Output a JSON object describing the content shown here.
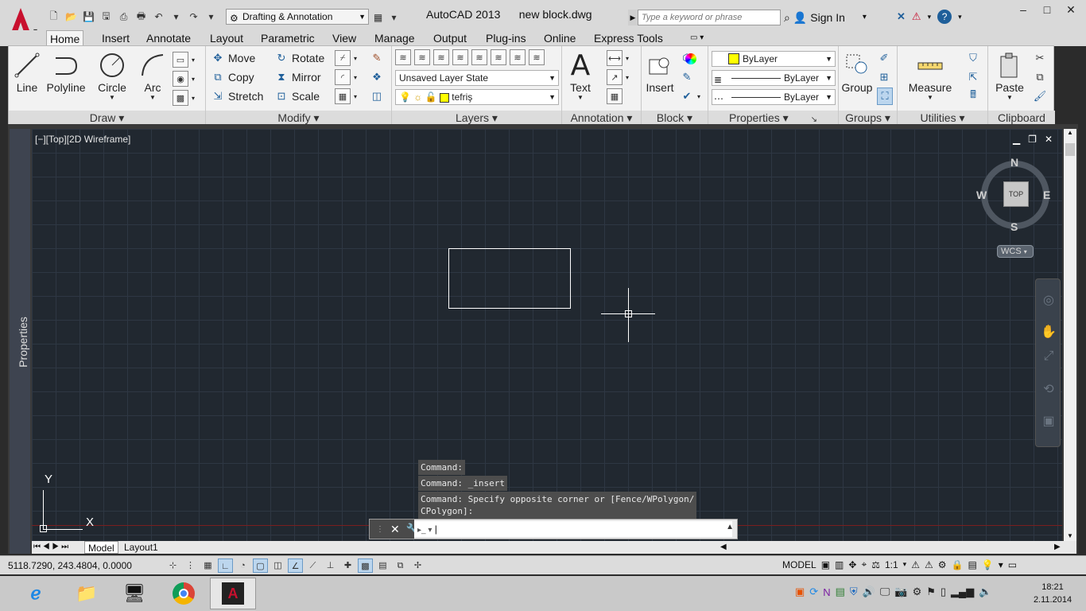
{
  "titlebar": {
    "workspace": "Drafting & Annotation",
    "app_name": "AutoCAD 2013",
    "document": "new block.dwg",
    "search_placeholder": "Type a keyword or phrase",
    "signin": "Sign In"
  },
  "ribbon_tabs": [
    "Home",
    "Insert",
    "Annotate",
    "Layout",
    "Parametric",
    "View",
    "Manage",
    "Output",
    "Plug-ins",
    "Online",
    "Express Tools"
  ],
  "ribbon": {
    "draw": {
      "title": "Draw",
      "line": "Line",
      "polyline": "Polyline",
      "circle": "Circle",
      "arc": "Arc"
    },
    "modify": {
      "title": "Modify",
      "move": "Move",
      "rotate": "Rotate",
      "copy": "Copy",
      "mirror": "Mirror",
      "stretch": "Stretch",
      "scale": "Scale"
    },
    "layers": {
      "title": "Layers",
      "layer_state": "Unsaved Layer State",
      "current_layer": "tefriş"
    },
    "annotation": {
      "title": "Annotation",
      "text": "Text"
    },
    "block": {
      "title": "Block",
      "insert": "Insert"
    },
    "properties": {
      "title": "Properties",
      "color": "ByLayer",
      "lineweight": "ByLayer",
      "linetype": "ByLayer"
    },
    "groups": {
      "title": "Groups",
      "group": "Group"
    },
    "utilities": {
      "title": "Utilities",
      "measure": "Measure"
    },
    "clipboard": {
      "title": "Clipboard",
      "paste": "Paste"
    }
  },
  "drawing": {
    "viewport_label": "[−][Top][2D Wireframe]",
    "properties_palette": "Properties",
    "viewcube": {
      "top": "TOP",
      "n": "N",
      "s": "S",
      "e": "E",
      "w": "W",
      "wcs": "WCS"
    },
    "ucs_x": "X",
    "ucs_y": "Y"
  },
  "command": {
    "history": [
      "Command:",
      "Command: _insert",
      "Command: Specify opposite corner or [Fence/WPolygon/",
      "CPolygon]:"
    ],
    "input": ""
  },
  "layout_tabs": [
    "Model",
    "Layout1"
  ],
  "statusbar": {
    "coords": "5118.7290, 243.4804, 0.0000",
    "space": "MODEL",
    "scale": "1:1"
  },
  "taskbar": {
    "time": "18:21",
    "date": "2.11.2014"
  }
}
